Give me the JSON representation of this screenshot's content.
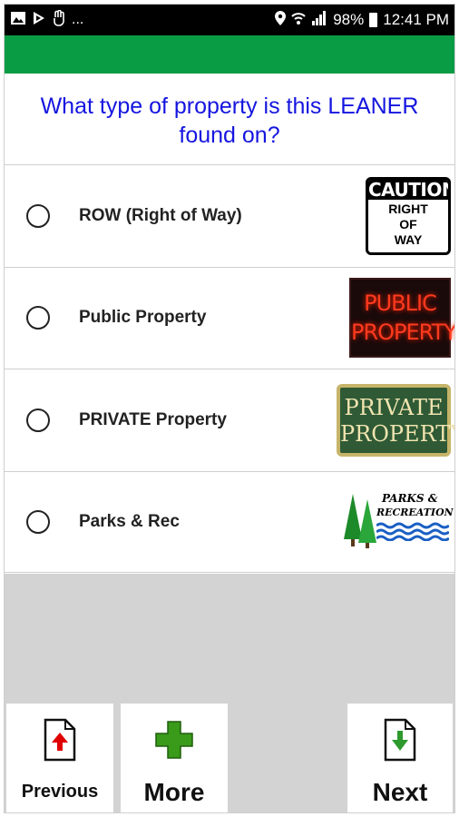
{
  "status_bar": {
    "left_icons": [
      "image-icon",
      "play-store-icon",
      "hand-icon",
      "more-icon"
    ],
    "more_text": "...",
    "battery": "98%",
    "time": "12:41 PM"
  },
  "question": "What type of property is this LEANER found on?",
  "options": [
    {
      "label": "ROW (Right of Way)",
      "image": {
        "top": "CAUTION",
        "lines": [
          "RIGHT",
          "OF",
          "WAY"
        ]
      }
    },
    {
      "label": "Public Property",
      "image": {
        "lines": [
          "PUBLIC",
          "PROPERTY"
        ]
      }
    },
    {
      "label": "PRIVATE Property",
      "image": {
        "lines": [
          "PRIVATE",
          "PROPERTY"
        ]
      }
    },
    {
      "label": "Parks & Rec",
      "image": {
        "lines": [
          "PARKS &",
          "RECREATION"
        ]
      }
    }
  ],
  "buttons": {
    "previous": "Previous",
    "more": "More",
    "next": "Next"
  },
  "colors": {
    "header_green": "#0a9b45",
    "question_blue": "#1515e0",
    "previous_arrow": "#e00000",
    "more_plus": "#3a9a1a",
    "next_arrow": "#2e9a2e"
  }
}
